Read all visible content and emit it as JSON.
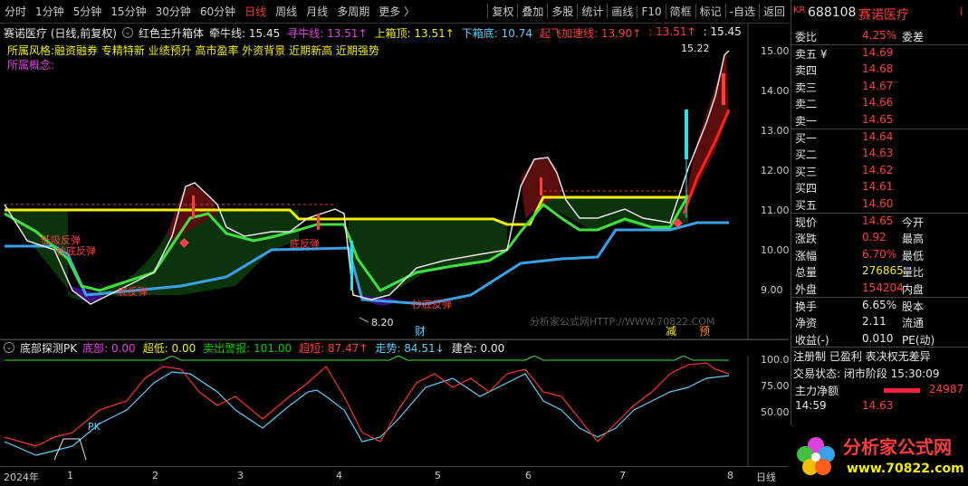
{
  "toolbar": {
    "periods": [
      "分时",
      "1分钟",
      "5分钟",
      "15分钟",
      "30分钟",
      "60分钟",
      "日线",
      "周线",
      "月线",
      "多周期",
      "更多 〉"
    ],
    "active_period": "日线",
    "tools": [
      "复权",
      "叠加",
      "多股",
      "统计",
      "画线",
      "F10",
      "简框",
      "标记",
      "-自选",
      "返回"
    ]
  },
  "main_indicator": {
    "stock_label": "赛诺医疗 (日线,前复权)",
    "indicator_name": "红色主升箱体",
    "items": [
      {
        "label": "牵牛线:",
        "value": "15.45",
        "color": "#e6e6e6"
      },
      {
        "label": "寻牛线:",
        "value": "13.51↑",
        "color": "#e040e0"
      },
      {
        "label": "上箱顶:",
        "value": "13.51↑",
        "color": "#f0f000"
      },
      {
        "label": "下箱底:",
        "value": "10.74",
        "color": "#5ad0ff"
      },
      {
        "label": "起飞加速线:",
        "value": "13.90↑",
        "color": "#ff3c3c"
      },
      {
        "label": ":",
        "value": "13.51↑",
        "color": "#ff3c3c"
      },
      {
        "label": ":",
        "value": "15.45",
        "color": "#e6e6e6"
      }
    ],
    "tags": "所属风格:融资融券  专精特新  业绩预升  高市盈率  外资背景  近期新高  近期强势",
    "concept": "所属概念:"
  },
  "price_axis": {
    "ticks": [
      "15.00",
      "14.00",
      "13.00",
      "12.00",
      "11.00",
      "10.00",
      "9.00"
    ]
  },
  "annotations": {
    "high_label": "15.22",
    "low_label": "8.20",
    "watermark": "分析家公式网HTTP://WWW.70822.COM",
    "markers": [
      "财",
      "减",
      "预"
    ],
    "signals": [
      "低吸反弹",
      "抄底反弹",
      "底反弹",
      "底反弹",
      "抄底反弹",
      "抄底反弹"
    ]
  },
  "sub_indicator": {
    "name": "底部探测PK",
    "items": [
      {
        "label": "底部:",
        "value": "0.00",
        "color": "#e040e0"
      },
      {
        "label": "超低:",
        "value": "0.00",
        "color": "#f0f000"
      },
      {
        "label": "卖出警报:",
        "value": "101.00",
        "color": "#00d000"
      },
      {
        "label": "超短:",
        "value": "87.47↑",
        "color": "#ff3c3c"
      },
      {
        "label": "走势:",
        "value": "84.51↓",
        "color": "#5ad0ff"
      },
      {
        "label": "建合:",
        "value": "0.00",
        "color": "#e6e6e6"
      }
    ],
    "pk_label": "PK",
    "ticks": [
      "100.0",
      "75.00",
      "50.00"
    ]
  },
  "time_axis": {
    "labels": [
      "2024年",
      "1",
      "2",
      "3",
      "4",
      "5",
      "6",
      "7",
      "8"
    ],
    "period": "日线"
  },
  "quote": {
    "code": "688108",
    "name": "赛诺医疗",
    "market": "KR",
    "weibi": {
      "label": "委比",
      "value": "4.25%",
      "label2": "委差"
    },
    "asks": [
      {
        "label": "卖五 ¥",
        "price": "14.69"
      },
      {
        "label": "卖四",
        "price": "14.68"
      },
      {
        "label": "卖三",
        "price": "14.67"
      },
      {
        "label": "卖二",
        "price": "14.66"
      },
      {
        "label": "卖一",
        "price": "14.65"
      }
    ],
    "bids": [
      {
        "label": "买一",
        "price": "14.64"
      },
      {
        "label": "买二",
        "price": "14.63"
      },
      {
        "label": "买三",
        "price": "14.62"
      },
      {
        "label": "买四",
        "price": "14.61"
      },
      {
        "label": "买五",
        "price": "14.60"
      }
    ],
    "stats": [
      {
        "l": "现价",
        "v": "14.65",
        "l2": "今开",
        "vc": "#ff3c3c"
      },
      {
        "l": "涨跌",
        "v": "0.92",
        "l2": "最高",
        "vc": "#ff3c3c"
      },
      {
        "l": "涨幅",
        "v": "6.70%",
        "l2": "最低",
        "vc": "#ff3c3c"
      },
      {
        "l": "总量",
        "v": "276865",
        "l2": "量比",
        "vc": "#f0f000"
      },
      {
        "l": "外盘",
        "v": "154204",
        "l2": "内盘",
        "vc": "#ff3c3c"
      }
    ],
    "stats2": [
      {
        "l": "换手",
        "v": "6.65%",
        "l2": "股本"
      },
      {
        "l": "净资",
        "v": "2.11",
        "l2": "流通"
      },
      {
        "l": "收益(-)",
        "v": "0.010",
        "l2": "PE(动)"
      }
    ],
    "status_tags": "注册制  已盈利  表决权无差异",
    "trade_status": "交易状态: 闭市阶段 15:30:09",
    "net_flow_label": "主力净额",
    "net_flow_value": "24987",
    "last_time": "14:59",
    "last_price": "14.63"
  },
  "logo": {
    "text": "分析家公式网",
    "url": "www.70822.com"
  }
}
